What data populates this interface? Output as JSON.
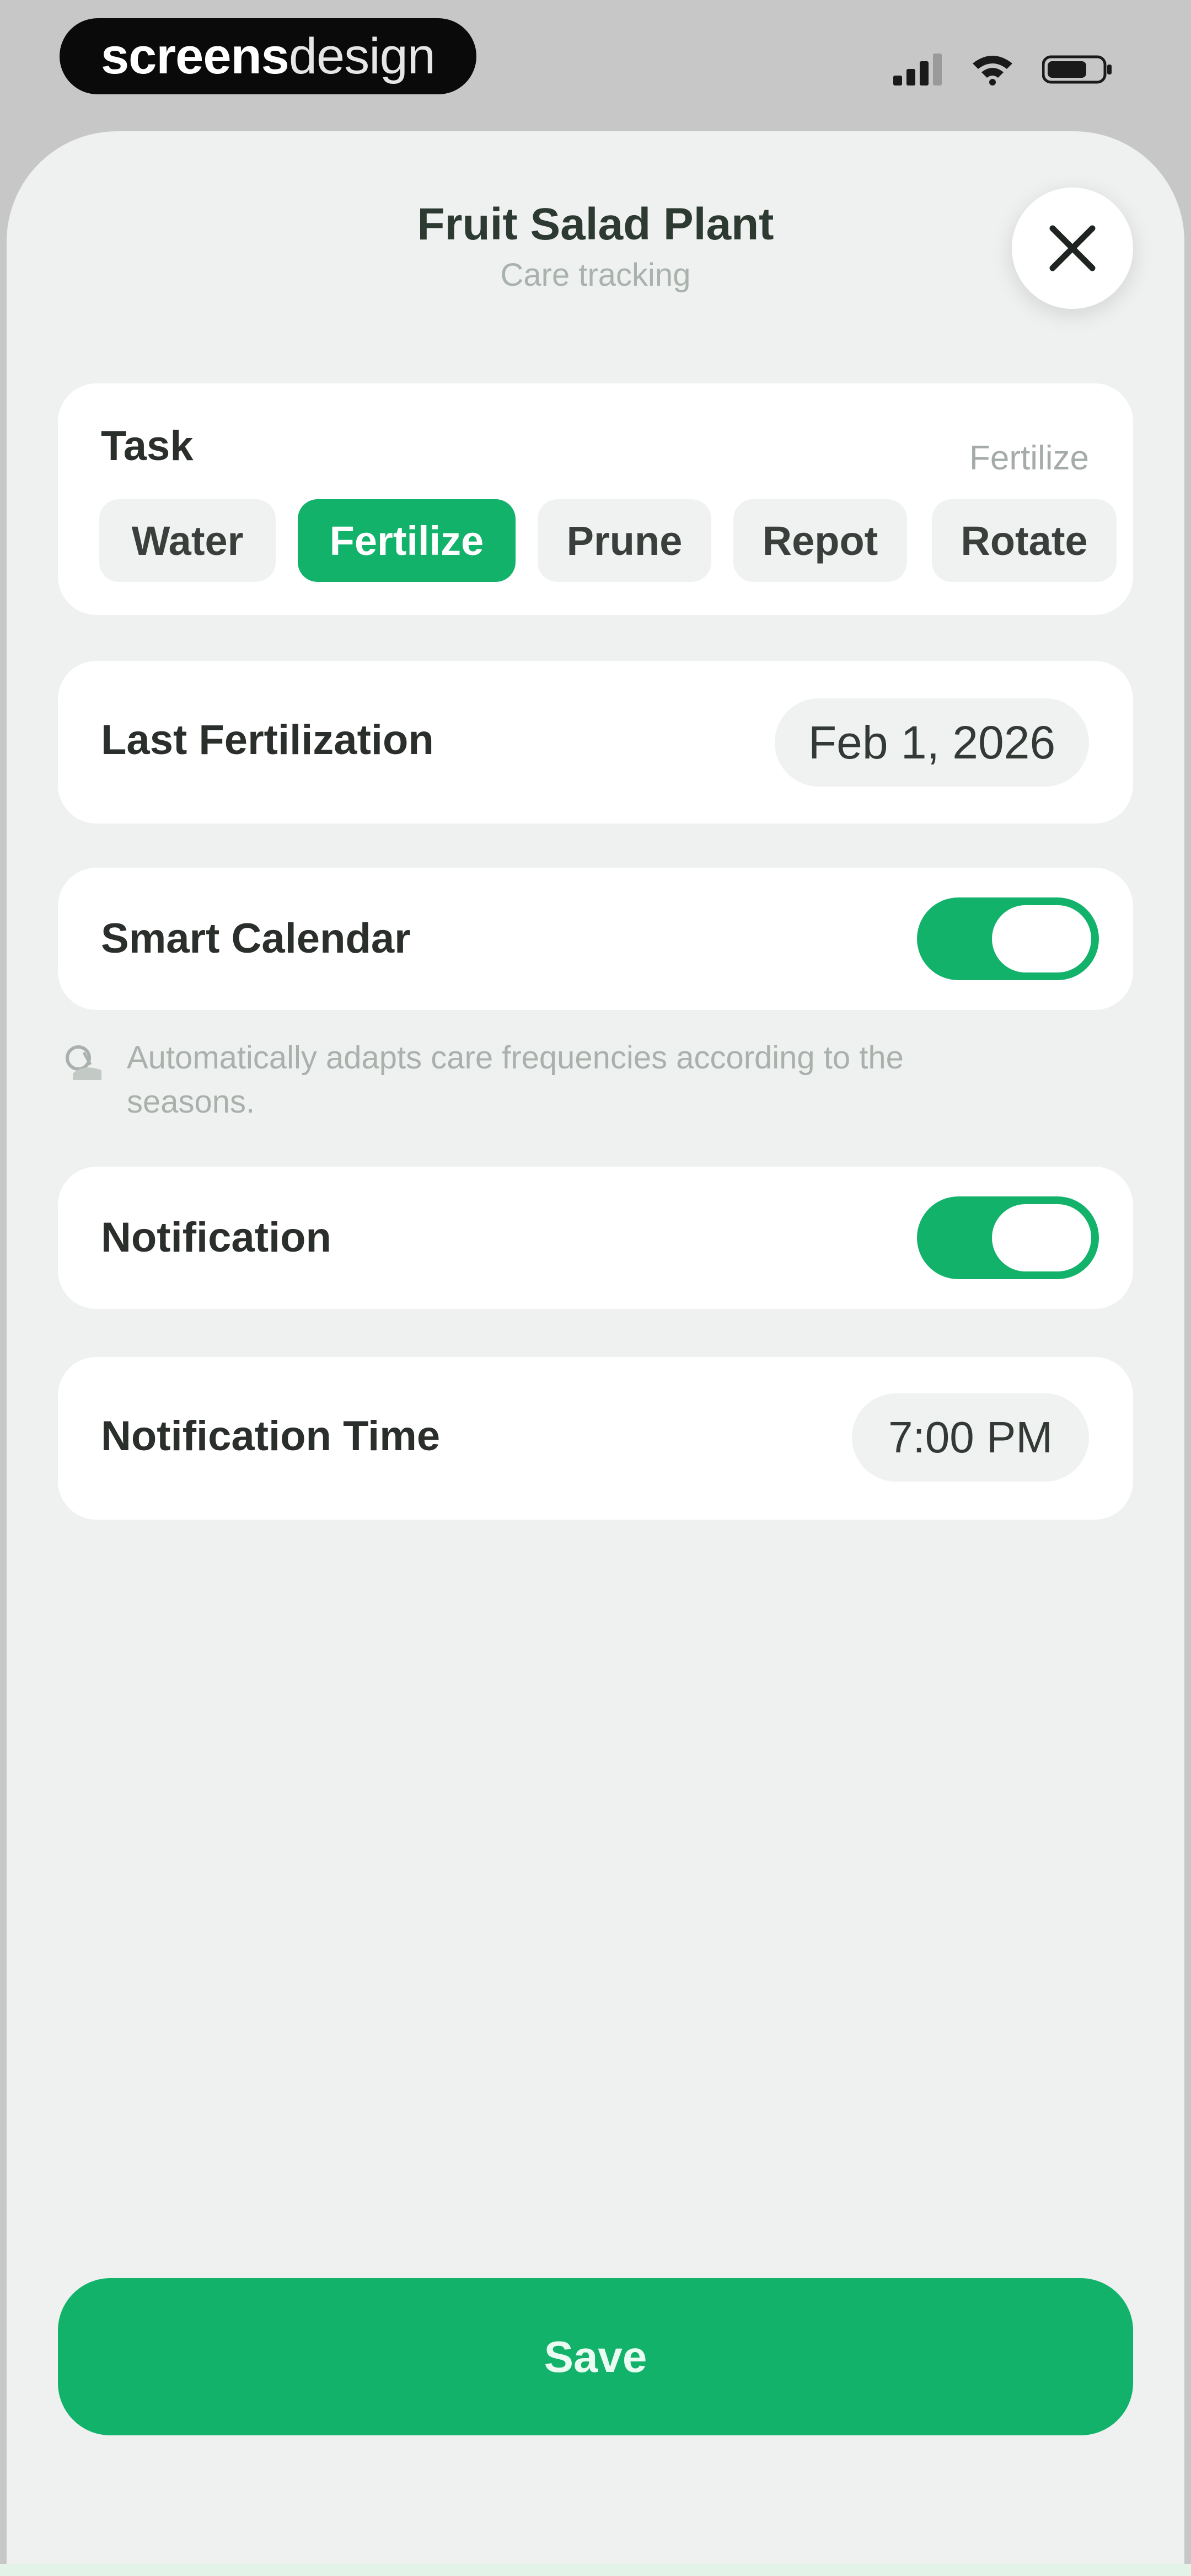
{
  "status_bar": {
    "brand_part1": "screens",
    "brand_part2": "design",
    "icons": [
      "cellular-signal-icon",
      "wifi-icon",
      "battery-icon"
    ]
  },
  "header": {
    "title": "Fruit Salad Plant",
    "subtitle": "Care tracking",
    "close_icon": "close-icon"
  },
  "task": {
    "label": "Task",
    "selected": "Fertilize",
    "options": [
      {
        "label": "Water",
        "selected": false
      },
      {
        "label": "Fertilize",
        "selected": true
      },
      {
        "label": "Prune",
        "selected": false
      },
      {
        "label": "Repot",
        "selected": false
      },
      {
        "label": "Rotate",
        "selected": false
      }
    ]
  },
  "last_fertilization": {
    "label": "Last Fertilization",
    "value": "Feb 1, 2026"
  },
  "smart_calendar": {
    "label": "Smart Calendar",
    "enabled": true,
    "note": "Automatically adapts care frequencies according to the seasons.",
    "note_icon": "seasons-icon"
  },
  "notification": {
    "label": "Notification",
    "enabled": true
  },
  "notification_time": {
    "label": "Notification Time",
    "value": "7:00 PM"
  },
  "save_button": {
    "label": "Save"
  },
  "colors": {
    "accent": "#12b26b",
    "background": "#eff1f0",
    "card": "#ffffff"
  }
}
